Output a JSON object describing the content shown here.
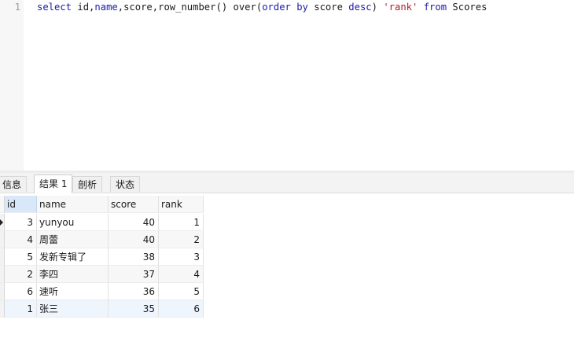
{
  "editor": {
    "line_number": "1",
    "tokens": {
      "select": "select",
      "cols": " id,",
      "name": "name",
      "rest1": ",score,row_number() over(",
      "order": "order",
      "sp1": " ",
      "by": "by",
      "sp2": " score ",
      "desc": "desc",
      "sp3": ") ",
      "alias": "'rank'",
      "sp4": " ",
      "from": "from",
      "table": " Scores"
    }
  },
  "tabs": [
    {
      "label": "信息"
    },
    {
      "label": "结果 1"
    },
    {
      "label": "剖析"
    },
    {
      "label": "状态"
    }
  ],
  "result": {
    "columns": [
      "id",
      "name",
      "score",
      "rank"
    ],
    "rows": [
      {
        "id": "3",
        "name": "yunyou",
        "score": "40",
        "rank": "1"
      },
      {
        "id": "4",
        "name": "周蕾",
        "score": "40",
        "rank": "2"
      },
      {
        "id": "5",
        "name": "发新专辑了",
        "score": "38",
        "rank": "3"
      },
      {
        "id": "2",
        "name": "李四",
        "score": "37",
        "rank": "4"
      },
      {
        "id": "6",
        "name": "速听",
        "score": "36",
        "rank": "5"
      },
      {
        "id": "1",
        "name": "张三",
        "score": "35",
        "rank": "6"
      }
    ],
    "current_row": 0
  }
}
